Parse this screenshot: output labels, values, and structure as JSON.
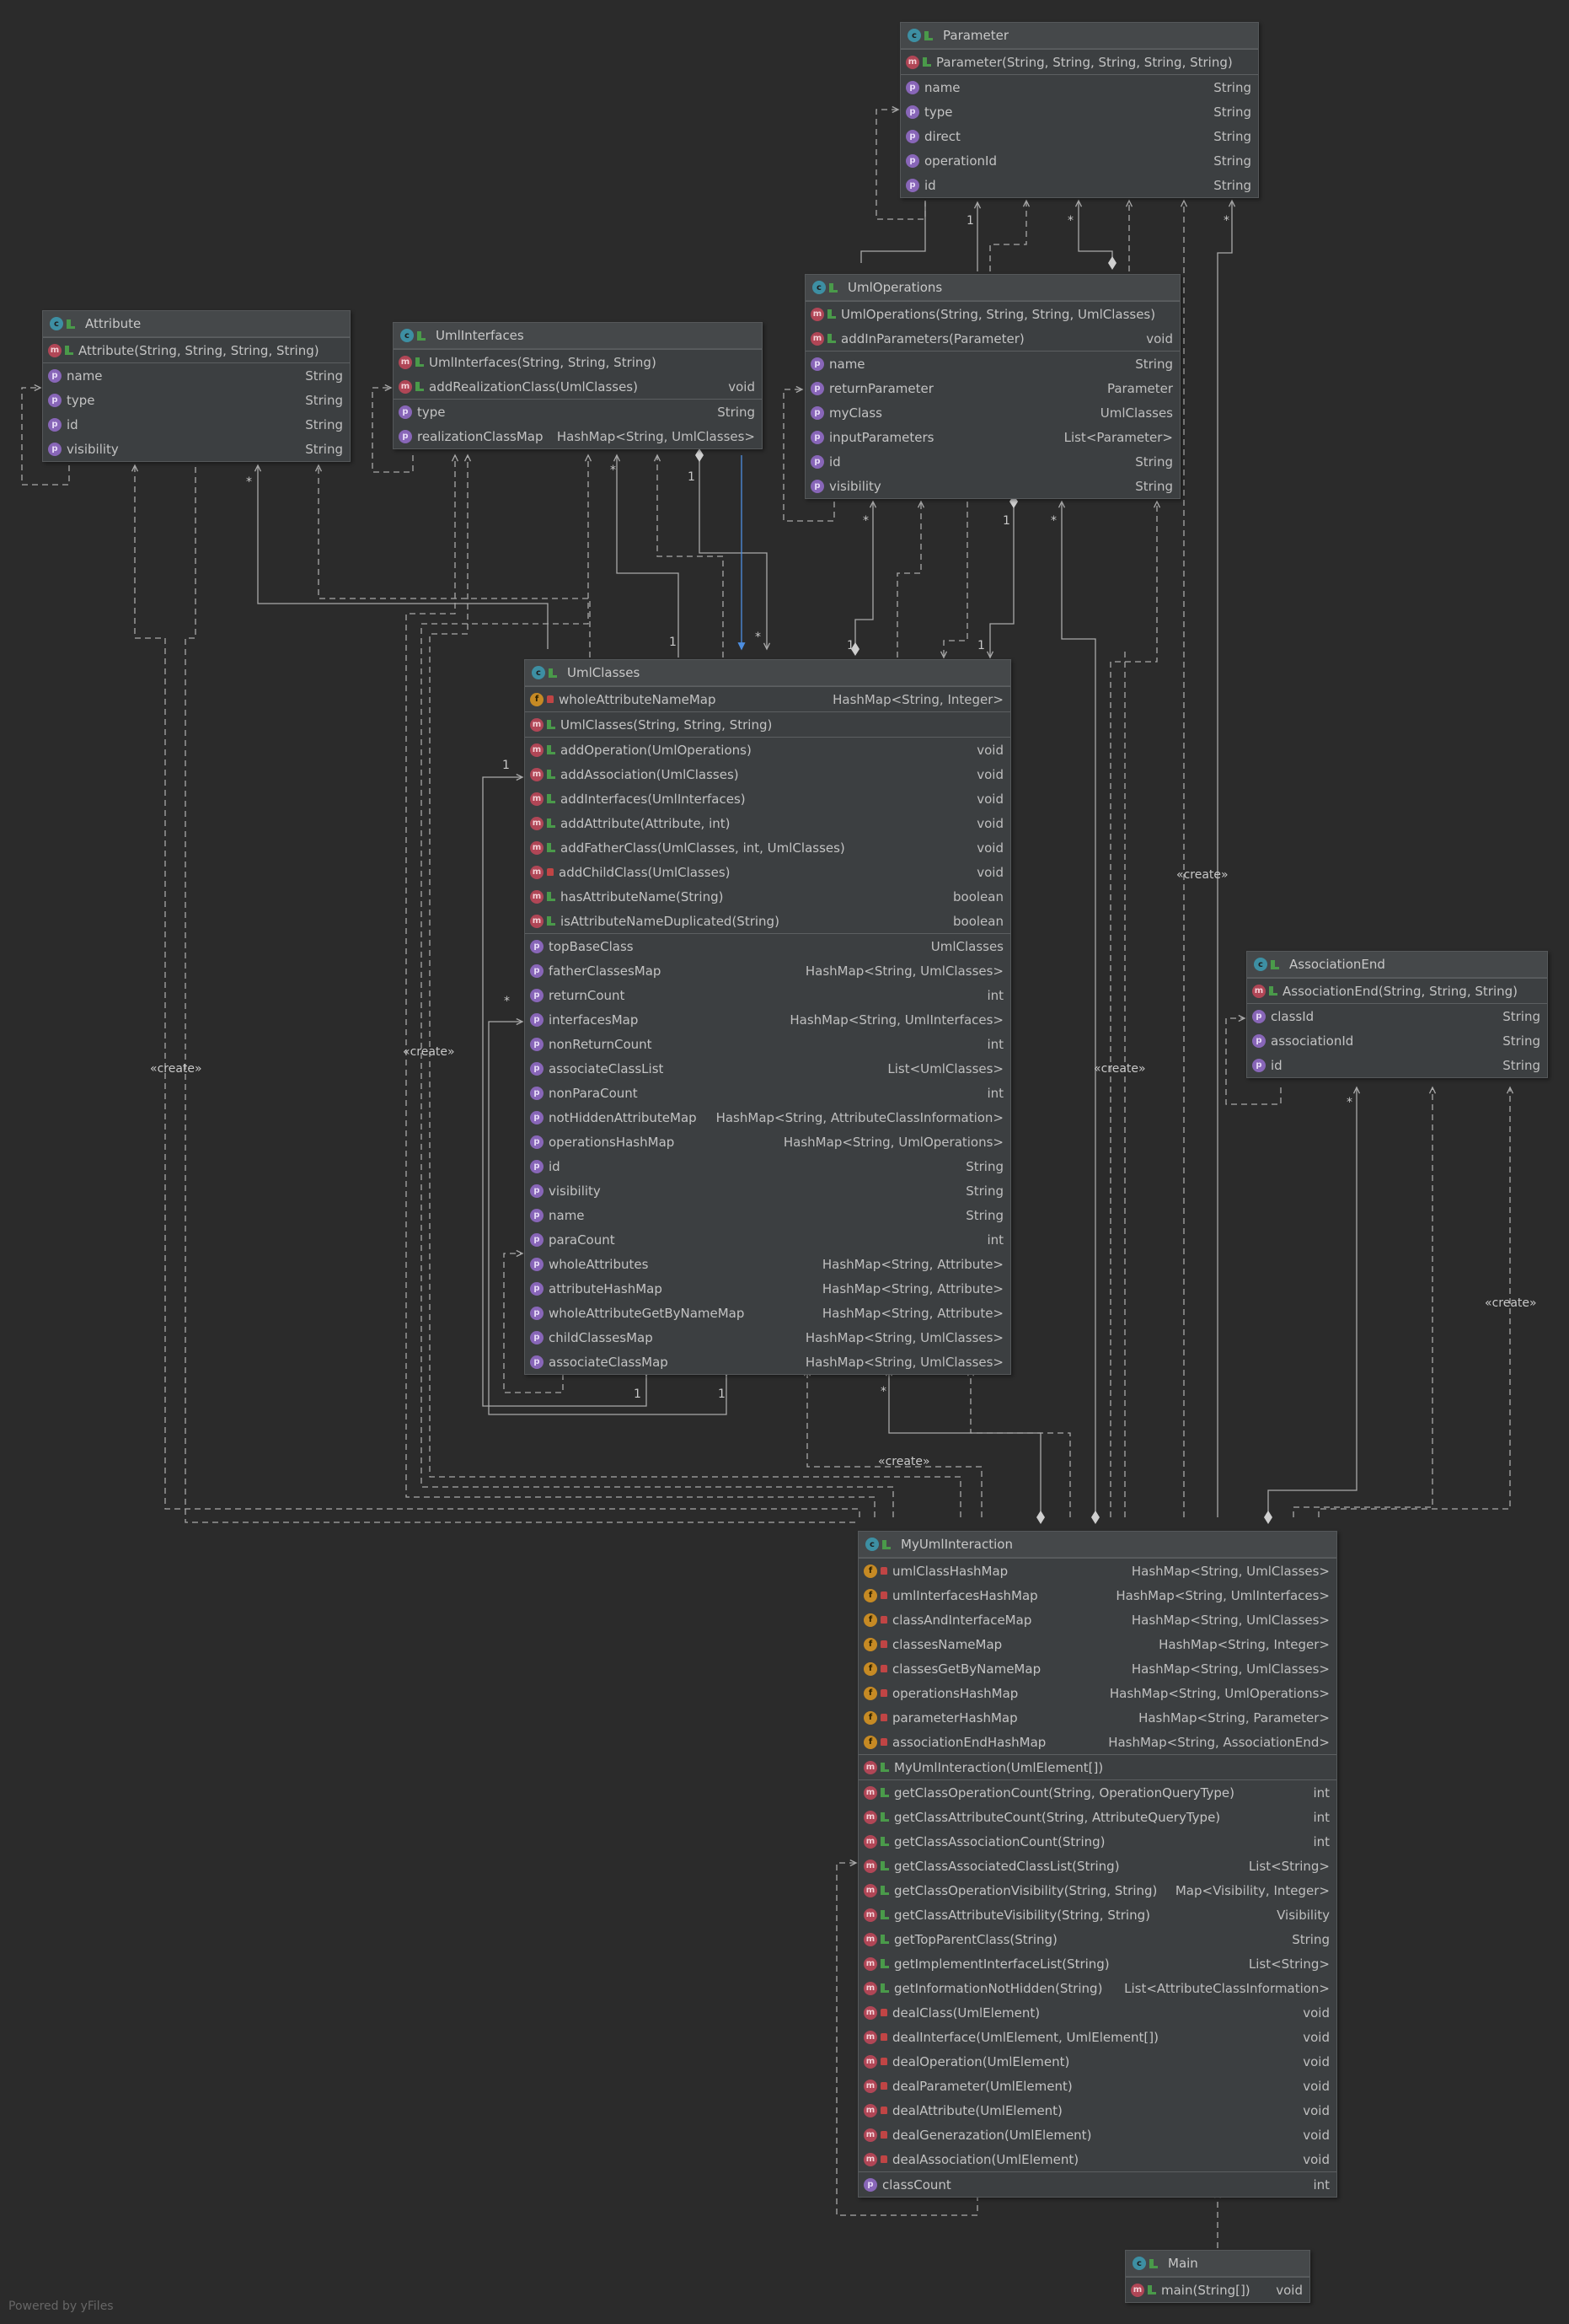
{
  "diagram": {
    "footer": "Powered by yFiles",
    "labels": {
      "create": "«create»",
      "one": "1",
      "many": "*"
    },
    "classes": {
      "parameter": {
        "name": "Parameter",
        "methods": [
          {
            "text": "Parameter(String, String, String, String, String)",
            "type": "",
            "badge": "m",
            "vis": "pub"
          }
        ],
        "fields": [
          {
            "text": "name",
            "type": "String",
            "badge": "p",
            "vis": "none"
          },
          {
            "text": "type",
            "type": "String",
            "badge": "p",
            "vis": "none"
          },
          {
            "text": "direct",
            "type": "String",
            "badge": "p",
            "vis": "none"
          },
          {
            "text": "operationId",
            "type": "String",
            "badge": "p",
            "vis": "none"
          },
          {
            "text": "id",
            "type": "String",
            "badge": "p",
            "vis": "none"
          }
        ]
      },
      "umlOperations": {
        "name": "UmlOperations",
        "methods": [
          {
            "text": "UmlOperations(String, String, String, UmlClasses)",
            "type": "",
            "badge": "m",
            "vis": "pub"
          },
          {
            "text": "addInParameters(Parameter)",
            "type": "void",
            "badge": "m",
            "vis": "pub"
          }
        ],
        "fields": [
          {
            "text": "name",
            "type": "String",
            "badge": "p",
            "vis": "none"
          },
          {
            "text": "returnParameter",
            "type": "Parameter",
            "badge": "p",
            "vis": "none"
          },
          {
            "text": "myClass",
            "type": "UmlClasses",
            "badge": "p",
            "vis": "none"
          },
          {
            "text": "inputParameters",
            "type": "List<Parameter>",
            "badge": "p",
            "vis": "none"
          },
          {
            "text": "id",
            "type": "String",
            "badge": "p",
            "vis": "none"
          },
          {
            "text": "visibility",
            "type": "String",
            "badge": "p",
            "vis": "none"
          }
        ]
      },
      "attribute": {
        "name": "Attribute",
        "methods": [
          {
            "text": "Attribute(String, String, String, String)",
            "type": "",
            "badge": "m",
            "vis": "pub"
          }
        ],
        "fields": [
          {
            "text": "name",
            "type": "String",
            "badge": "p",
            "vis": "none"
          },
          {
            "text": "type",
            "type": "String",
            "badge": "p",
            "vis": "none"
          },
          {
            "text": "id",
            "type": "String",
            "badge": "p",
            "vis": "none"
          },
          {
            "text": "visibility",
            "type": "String",
            "badge": "p",
            "vis": "none"
          }
        ]
      },
      "umlInterfaces": {
        "name": "UmlInterfaces",
        "methods": [
          {
            "text": "UmlInterfaces(String, String, String)",
            "type": "",
            "badge": "m",
            "vis": "pub"
          },
          {
            "text": "addRealizationClass(UmlClasses)",
            "type": "void",
            "badge": "m",
            "vis": "pub"
          }
        ],
        "fields": [
          {
            "text": "type",
            "type": "String",
            "badge": "p",
            "vis": "none"
          },
          {
            "text": "realizationClassMap",
            "type": "HashMap<String, UmlClasses>",
            "badge": "p",
            "vis": "none"
          }
        ]
      },
      "umlClasses": {
        "name": "UmlClasses",
        "privFields": [
          {
            "text": "wholeAttributeNameMap",
            "type": "HashMap<String, Integer>",
            "badge": "f",
            "vis": "priv"
          }
        ],
        "ctors": [
          {
            "text": "UmlClasses(String, String, String)",
            "type": "",
            "badge": "m",
            "vis": "pub"
          }
        ],
        "methods": [
          {
            "text": "addOperation(UmlOperations)",
            "type": "void",
            "badge": "m",
            "vis": "pub"
          },
          {
            "text": "addAssociation(UmlClasses)",
            "type": "void",
            "badge": "m",
            "vis": "pub"
          },
          {
            "text": "addInterfaces(UmlInterfaces)",
            "type": "void",
            "badge": "m",
            "vis": "pub"
          },
          {
            "text": "addAttribute(Attribute, int)",
            "type": "void",
            "badge": "m",
            "vis": "pub"
          },
          {
            "text": "addFatherClass(UmlClasses, int, UmlClasses)",
            "type": "void",
            "badge": "m",
            "vis": "pub"
          },
          {
            "text": "addChildClass(UmlClasses)",
            "type": "void",
            "badge": "m",
            "vis": "priv"
          },
          {
            "text": "hasAttributeName(String)",
            "type": "boolean",
            "badge": "m",
            "vis": "pub"
          },
          {
            "text": "isAttributeNameDuplicated(String)",
            "type": "boolean",
            "badge": "m",
            "vis": "pub"
          }
        ],
        "fields": [
          {
            "text": "topBaseClass",
            "type": "UmlClasses",
            "badge": "p",
            "vis": "none"
          },
          {
            "text": "fatherClassesMap",
            "type": "HashMap<String, UmlClasses>",
            "badge": "p",
            "vis": "none"
          },
          {
            "text": "returnCount",
            "type": "int",
            "badge": "p",
            "vis": "none"
          },
          {
            "text": "interfacesMap",
            "type": "HashMap<String, UmlInterfaces>",
            "badge": "p",
            "vis": "none"
          },
          {
            "text": "nonReturnCount",
            "type": "int",
            "badge": "p",
            "vis": "none"
          },
          {
            "text": "associateClassList",
            "type": "List<UmlClasses>",
            "badge": "p",
            "vis": "none"
          },
          {
            "text": "nonParaCount",
            "type": "int",
            "badge": "p",
            "vis": "none"
          },
          {
            "text": "notHiddenAttributeMap",
            "type": "HashMap<String, AttributeClassInformation>",
            "badge": "p",
            "vis": "none"
          },
          {
            "text": "operationsHashMap",
            "type": "HashMap<String, UmlOperations>",
            "badge": "p",
            "vis": "none"
          },
          {
            "text": "id",
            "type": "String",
            "badge": "p",
            "vis": "none"
          },
          {
            "text": "visibility",
            "type": "String",
            "badge": "p",
            "vis": "none"
          },
          {
            "text": "name",
            "type": "String",
            "badge": "p",
            "vis": "none"
          },
          {
            "text": "paraCount",
            "type": "int",
            "badge": "p",
            "vis": "none"
          },
          {
            "text": "wholeAttributes",
            "type": "HashMap<String, Attribute>",
            "badge": "p",
            "vis": "none"
          },
          {
            "text": "attributeHashMap",
            "type": "HashMap<String, Attribute>",
            "badge": "p",
            "vis": "none"
          },
          {
            "text": "wholeAttributeGetByNameMap",
            "type": "HashMap<String, Attribute>",
            "badge": "p",
            "vis": "none"
          },
          {
            "text": "childClassesMap",
            "type": "HashMap<String, UmlClasses>",
            "badge": "p",
            "vis": "none"
          },
          {
            "text": "associateClassMap",
            "type": "HashMap<String, UmlClasses>",
            "badge": "p",
            "vis": "none"
          }
        ]
      },
      "associationEnd": {
        "name": "AssociationEnd",
        "methods": [
          {
            "text": "AssociationEnd(String, String, String)",
            "type": "",
            "badge": "m",
            "vis": "pub"
          }
        ],
        "fields": [
          {
            "text": "classId",
            "type": "String",
            "badge": "p",
            "vis": "none"
          },
          {
            "text": "associationId",
            "type": "String",
            "badge": "p",
            "vis": "none"
          },
          {
            "text": "id",
            "type": "String",
            "badge": "p",
            "vis": "none"
          }
        ]
      },
      "myUmlInteraction": {
        "name": "MyUmlInteraction",
        "privFields": [
          {
            "text": "umlClassHashMap",
            "type": "HashMap<String, UmlClasses>",
            "badge": "f",
            "vis": "priv"
          },
          {
            "text": "umlInterfacesHashMap",
            "type": "HashMap<String, UmlInterfaces>",
            "badge": "f",
            "vis": "priv"
          },
          {
            "text": "classAndInterfaceMap",
            "type": "HashMap<String, UmlClasses>",
            "badge": "f",
            "vis": "priv"
          },
          {
            "text": "classesNameMap",
            "type": "HashMap<String, Integer>",
            "badge": "f",
            "vis": "priv"
          },
          {
            "text": "classesGetByNameMap",
            "type": "HashMap<String, UmlClasses>",
            "badge": "f",
            "vis": "priv"
          },
          {
            "text": "operationsHashMap",
            "type": "HashMap<String, UmlOperations>",
            "badge": "f",
            "vis": "priv"
          },
          {
            "text": "parameterHashMap",
            "type": "HashMap<String, Parameter>",
            "badge": "f",
            "vis": "priv"
          },
          {
            "text": "associationEndHashMap",
            "type": "HashMap<String, AssociationEnd>",
            "badge": "f",
            "vis": "priv"
          }
        ],
        "ctors": [
          {
            "text": "MyUmlInteraction(UmlElement[])",
            "type": "",
            "badge": "m",
            "vis": "pub"
          }
        ],
        "methods": [
          {
            "text": "getClassOperationCount(String, OperationQueryType)",
            "type": "int",
            "badge": "m",
            "vis": "pub"
          },
          {
            "text": "getClassAttributeCount(String, AttributeQueryType)",
            "type": "int",
            "badge": "m",
            "vis": "pub"
          },
          {
            "text": "getClassAssociationCount(String)",
            "type": "int",
            "badge": "m",
            "vis": "pub"
          },
          {
            "text": "getClassAssociatedClassList(String)",
            "type": "List<String>",
            "badge": "m",
            "vis": "pub"
          },
          {
            "text": "getClassOperationVisibility(String, String)",
            "type": "Map<Visibility, Integer>",
            "badge": "m",
            "vis": "pub"
          },
          {
            "text": "getClassAttributeVisibility(String, String)",
            "type": "Visibility",
            "badge": "m",
            "vis": "pub"
          },
          {
            "text": "getTopParentClass(String)",
            "type": "String",
            "badge": "m",
            "vis": "pub"
          },
          {
            "text": "getImplementInterfaceList(String)",
            "type": "List<String>",
            "badge": "m",
            "vis": "pub"
          },
          {
            "text": "getInformationNotHidden(String)",
            "type": "List<AttributeClassInformation>",
            "badge": "m",
            "vis": "pub"
          },
          {
            "text": "dealClass(UmlElement)",
            "type": "void",
            "badge": "m",
            "vis": "priv"
          },
          {
            "text": "dealInterface(UmlElement, UmlElement[])",
            "type": "void",
            "badge": "m",
            "vis": "priv"
          },
          {
            "text": "dealOperation(UmlElement)",
            "type": "void",
            "badge": "m",
            "vis": "priv"
          },
          {
            "text": "dealParameter(UmlElement)",
            "type": "void",
            "badge": "m",
            "vis": "priv"
          },
          {
            "text": "dealAttribute(UmlElement)",
            "type": "void",
            "badge": "m",
            "vis": "priv"
          },
          {
            "text": "dealGenerazation(UmlElement)",
            "type": "void",
            "badge": "m",
            "vis": "priv"
          },
          {
            "text": "dealAssociation(UmlElement)",
            "type": "void",
            "badge": "m",
            "vis": "priv"
          }
        ],
        "fields": [
          {
            "text": "classCount",
            "type": "int",
            "badge": "p",
            "vis": "none"
          }
        ]
      },
      "main": {
        "name": "Main",
        "methods": [
          {
            "text": "main(String[])",
            "type": "void",
            "badge": "m",
            "vis": "pub"
          }
        ]
      }
    }
  }
}
